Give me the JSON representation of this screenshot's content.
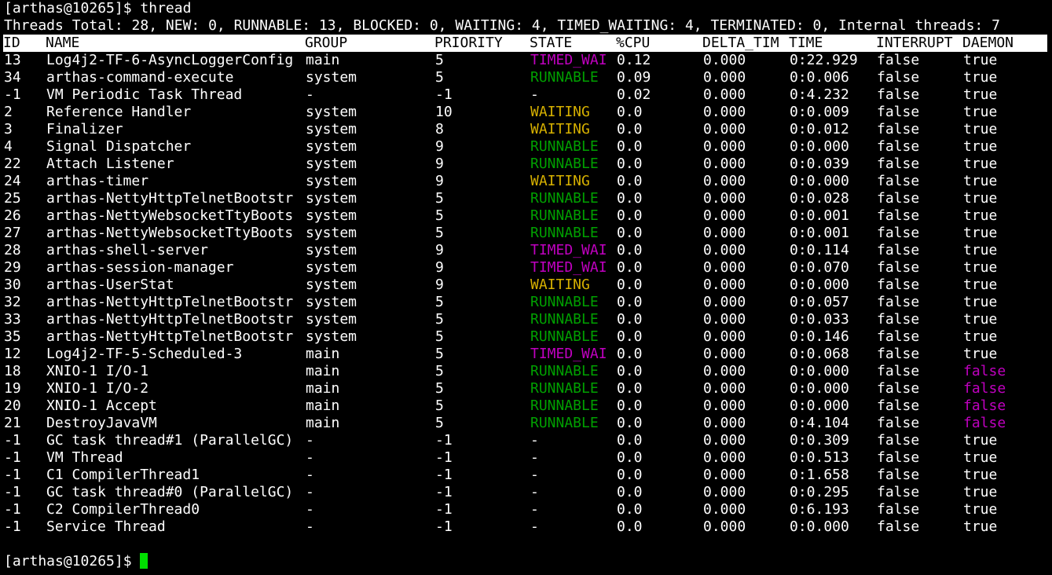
{
  "colors": {
    "background": "#000000",
    "foreground": "#ffffff",
    "header_bg": "#ffffff",
    "header_fg": "#000000",
    "runnable": "#00a000",
    "waiting": "#d6b000",
    "timed_waiting": "#c000c0",
    "daemon_false": "#c000c0",
    "cursor": "#00e000"
  },
  "prompt": {
    "text": "[arthas@10265]$ ",
    "command": "thread"
  },
  "summary": "Threads Total: 28, NEW: 0, RUNNABLE: 13, BLOCKED: 0, WAITING: 4, TIMED_WAITING: 4, TERMINATED: 0, Internal threads: 7",
  "columns": [
    "ID",
    "NAME",
    "GROUP",
    "PRIORITY",
    "STATE",
    "%CPU",
    "DELTA_TIM",
    "TIME",
    "INTERRUPT",
    "DAEMON"
  ],
  "rows": [
    {
      "id": "13",
      "name": "Log4j2-TF-6-AsyncLoggerConfig",
      "group": "main",
      "priority": "5",
      "state": "TIMED_WAI",
      "cpu": "0.12",
      "delta": "0.000",
      "time": "0:22.929",
      "interrupt": "false",
      "daemon": "true"
    },
    {
      "id": "34",
      "name": "arthas-command-execute",
      "group": "system",
      "priority": "5",
      "state": "RUNNABLE",
      "cpu": "0.09",
      "delta": "0.000",
      "time": "0:0.006",
      "interrupt": "false",
      "daemon": "true"
    },
    {
      "id": "-1",
      "name": "VM Periodic Task Thread",
      "group": "-",
      "priority": "-1",
      "state": "-",
      "cpu": "0.02",
      "delta": "0.000",
      "time": "0:4.232",
      "interrupt": "false",
      "daemon": "true"
    },
    {
      "id": "2",
      "name": "Reference Handler",
      "group": "system",
      "priority": "10",
      "state": "WAITING",
      "cpu": "0.0",
      "delta": "0.000",
      "time": "0:0.009",
      "interrupt": "false",
      "daemon": "true"
    },
    {
      "id": "3",
      "name": "Finalizer",
      "group": "system",
      "priority": "8",
      "state": "WAITING",
      "cpu": "0.0",
      "delta": "0.000",
      "time": "0:0.012",
      "interrupt": "false",
      "daemon": "true"
    },
    {
      "id": "4",
      "name": "Signal Dispatcher",
      "group": "system",
      "priority": "9",
      "state": "RUNNABLE",
      "cpu": "0.0",
      "delta": "0.000",
      "time": "0:0.000",
      "interrupt": "false",
      "daemon": "true"
    },
    {
      "id": "22",
      "name": "Attach Listener",
      "group": "system",
      "priority": "9",
      "state": "RUNNABLE",
      "cpu": "0.0",
      "delta": "0.000",
      "time": "0:0.039",
      "interrupt": "false",
      "daemon": "true"
    },
    {
      "id": "24",
      "name": "arthas-timer",
      "group": "system",
      "priority": "9",
      "state": "WAITING",
      "cpu": "0.0",
      "delta": "0.000",
      "time": "0:0.000",
      "interrupt": "false",
      "daemon": "true"
    },
    {
      "id": "25",
      "name": "arthas-NettyHttpTelnetBootstr",
      "group": "system",
      "priority": "5",
      "state": "RUNNABLE",
      "cpu": "0.0",
      "delta": "0.000",
      "time": "0:0.028",
      "interrupt": "false",
      "daemon": "true"
    },
    {
      "id": "26",
      "name": "arthas-NettyWebsocketTtyBoots",
      "group": "system",
      "priority": "5",
      "state": "RUNNABLE",
      "cpu": "0.0",
      "delta": "0.000",
      "time": "0:0.001",
      "interrupt": "false",
      "daemon": "true"
    },
    {
      "id": "27",
      "name": "arthas-NettyWebsocketTtyBoots",
      "group": "system",
      "priority": "5",
      "state": "RUNNABLE",
      "cpu": "0.0",
      "delta": "0.000",
      "time": "0:0.001",
      "interrupt": "false",
      "daemon": "true"
    },
    {
      "id": "28",
      "name": "arthas-shell-server",
      "group": "system",
      "priority": "9",
      "state": "TIMED_WAI",
      "cpu": "0.0",
      "delta": "0.000",
      "time": "0:0.114",
      "interrupt": "false",
      "daemon": "true"
    },
    {
      "id": "29",
      "name": "arthas-session-manager",
      "group": "system",
      "priority": "9",
      "state": "TIMED_WAI",
      "cpu": "0.0",
      "delta": "0.000",
      "time": "0:0.070",
      "interrupt": "false",
      "daemon": "true"
    },
    {
      "id": "30",
      "name": "arthas-UserStat",
      "group": "system",
      "priority": "9",
      "state": "WAITING",
      "cpu": "0.0",
      "delta": "0.000",
      "time": "0:0.000",
      "interrupt": "false",
      "daemon": "true"
    },
    {
      "id": "32",
      "name": "arthas-NettyHttpTelnetBootstr",
      "group": "system",
      "priority": "5",
      "state": "RUNNABLE",
      "cpu": "0.0",
      "delta": "0.000",
      "time": "0:0.057",
      "interrupt": "false",
      "daemon": "true"
    },
    {
      "id": "33",
      "name": "arthas-NettyHttpTelnetBootstr",
      "group": "system",
      "priority": "5",
      "state": "RUNNABLE",
      "cpu": "0.0",
      "delta": "0.000",
      "time": "0:0.033",
      "interrupt": "false",
      "daemon": "true"
    },
    {
      "id": "35",
      "name": "arthas-NettyHttpTelnetBootstr",
      "group": "system",
      "priority": "5",
      "state": "RUNNABLE",
      "cpu": "0.0",
      "delta": "0.000",
      "time": "0:0.146",
      "interrupt": "false",
      "daemon": "true"
    },
    {
      "id": "12",
      "name": "Log4j2-TF-5-Scheduled-3",
      "group": "main",
      "priority": "5",
      "state": "TIMED_WAI",
      "cpu": "0.0",
      "delta": "0.000",
      "time": "0:0.068",
      "interrupt": "false",
      "daemon": "true"
    },
    {
      "id": "18",
      "name": "XNIO-1 I/O-1",
      "group": "main",
      "priority": "5",
      "state": "RUNNABLE",
      "cpu": "0.0",
      "delta": "0.000",
      "time": "0:0.000",
      "interrupt": "false",
      "daemon": "false"
    },
    {
      "id": "19",
      "name": "XNIO-1 I/O-2",
      "group": "main",
      "priority": "5",
      "state": "RUNNABLE",
      "cpu": "0.0",
      "delta": "0.000",
      "time": "0:0.000",
      "interrupt": "false",
      "daemon": "false"
    },
    {
      "id": "20",
      "name": "XNIO-1 Accept",
      "group": "main",
      "priority": "5",
      "state": "RUNNABLE",
      "cpu": "0.0",
      "delta": "0.000",
      "time": "0:0.000",
      "interrupt": "false",
      "daemon": "false"
    },
    {
      "id": "21",
      "name": "DestroyJavaVM",
      "group": "main",
      "priority": "5",
      "state": "RUNNABLE",
      "cpu": "0.0",
      "delta": "0.000",
      "time": "0:4.104",
      "interrupt": "false",
      "daemon": "false"
    },
    {
      "id": "-1",
      "name": "GC task thread#1 (ParallelGC)",
      "group": "-",
      "priority": "-1",
      "state": "-",
      "cpu": "0.0",
      "delta": "0.000",
      "time": "0:0.309",
      "interrupt": "false",
      "daemon": "true"
    },
    {
      "id": "-1",
      "name": "VM Thread",
      "group": "-",
      "priority": "-1",
      "state": "-",
      "cpu": "0.0",
      "delta": "0.000",
      "time": "0:0.513",
      "interrupt": "false",
      "daemon": "true"
    },
    {
      "id": "-1",
      "name": "C1 CompilerThread1",
      "group": "-",
      "priority": "-1",
      "state": "-",
      "cpu": "0.0",
      "delta": "0.000",
      "time": "0:1.658",
      "interrupt": "false",
      "daemon": "true"
    },
    {
      "id": "-1",
      "name": "GC task thread#0 (ParallelGC)",
      "group": "-",
      "priority": "-1",
      "state": "-",
      "cpu": "0.0",
      "delta": "0.000",
      "time": "0:0.295",
      "interrupt": "false",
      "daemon": "true"
    },
    {
      "id": "-1",
      "name": "C2 CompilerThread0",
      "group": "-",
      "priority": "-1",
      "state": "-",
      "cpu": "0.0",
      "delta": "0.000",
      "time": "0:6.193",
      "interrupt": "false",
      "daemon": "true"
    },
    {
      "id": "-1",
      "name": "Service Thread",
      "group": "-",
      "priority": "-1",
      "state": "-",
      "cpu": "0.0",
      "delta": "0.000",
      "time": "0:0.000",
      "interrupt": "false",
      "daemon": "true"
    }
  ],
  "final_prompt": "[arthas@10265]$ "
}
